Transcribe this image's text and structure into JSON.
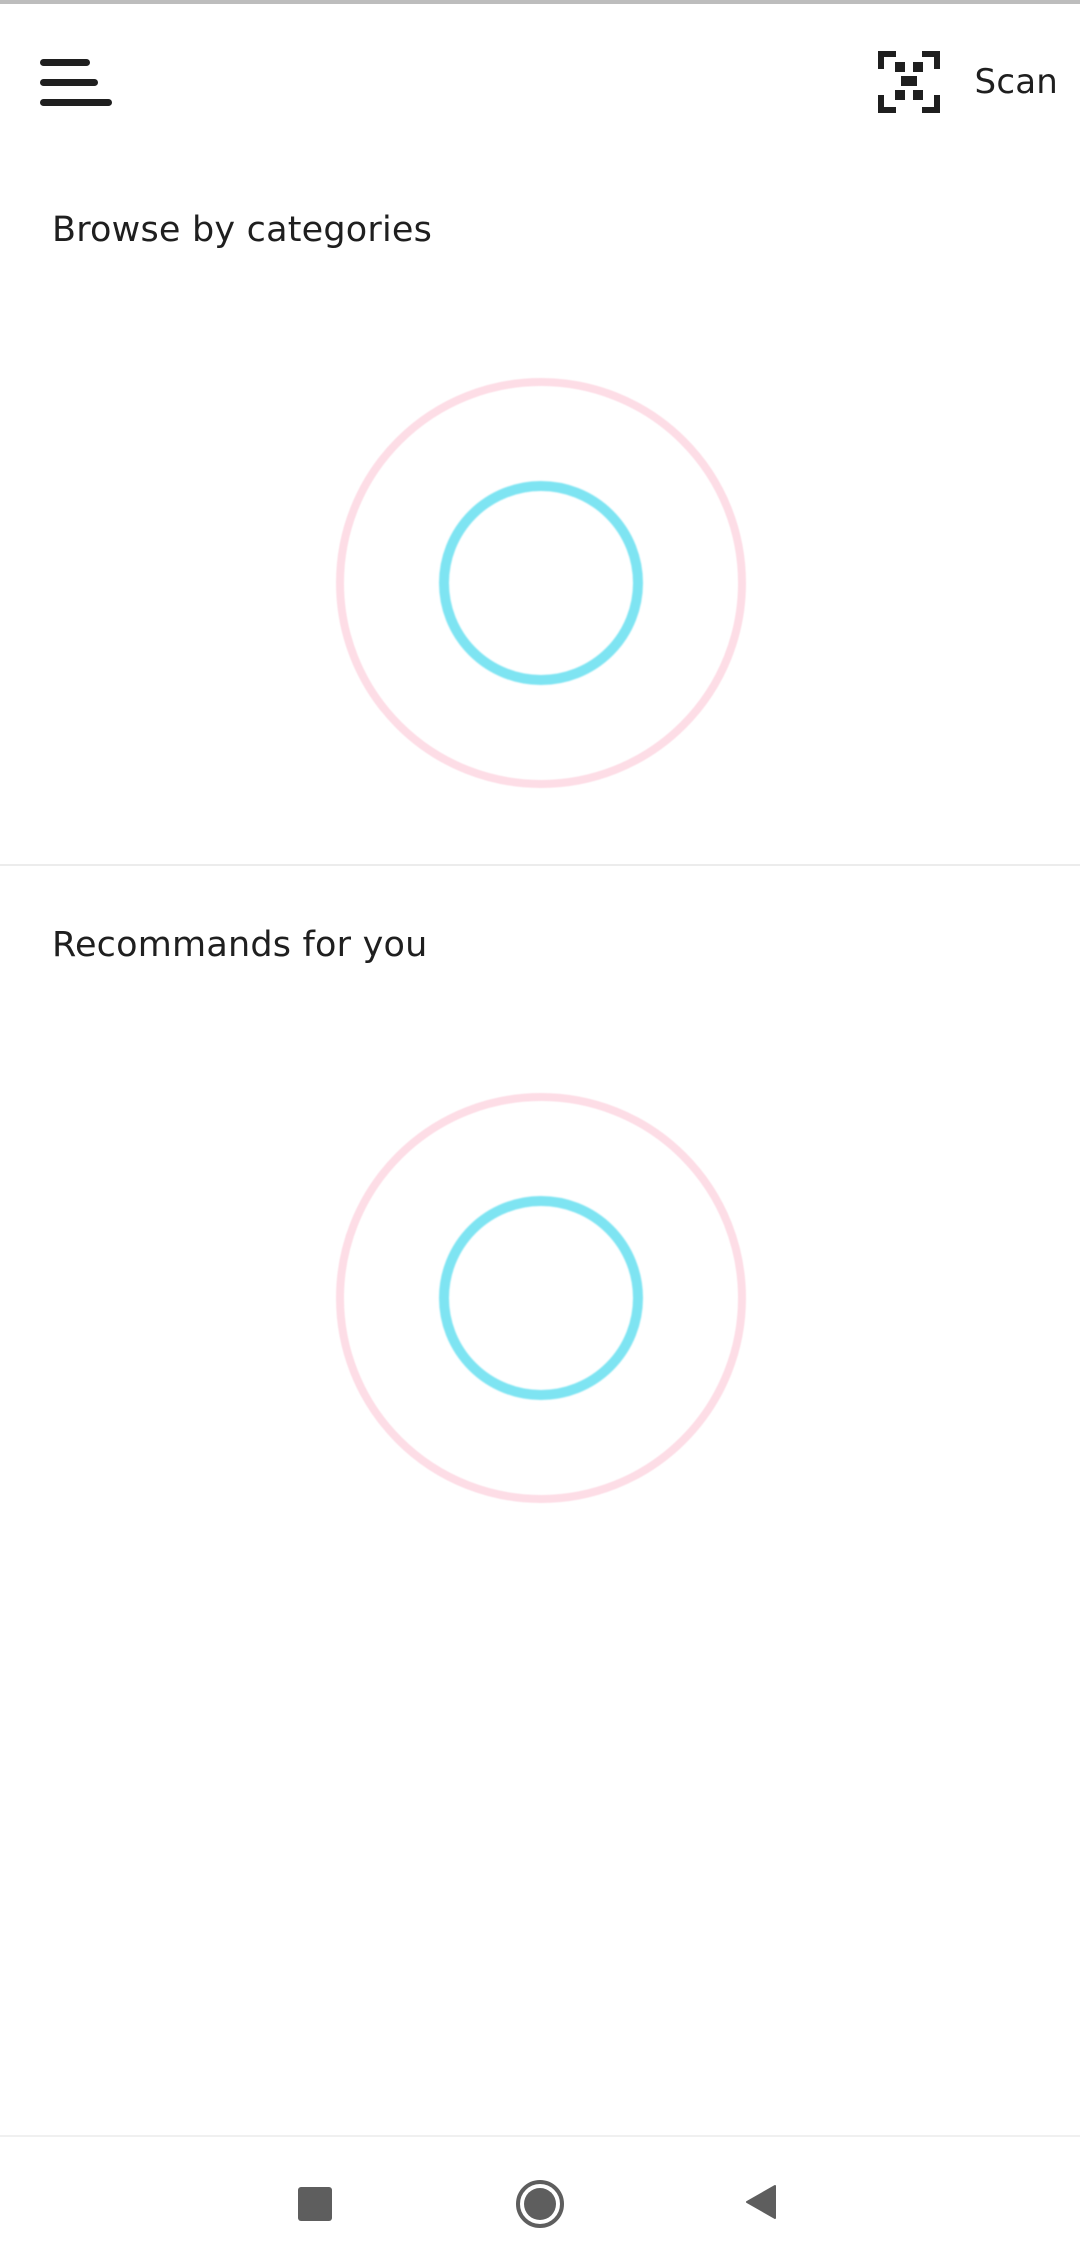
{
  "header": {
    "menu_icon": "hamburger-menu-icon",
    "scan_icon": "qr-scan-icon",
    "scan_label": "Scan"
  },
  "sections": [
    {
      "title": "Browse by categories",
      "loading_indicator": "double-ring-spinner"
    },
    {
      "title": "Recommands for you",
      "loading_indicator": "double-ring-spinner"
    }
  ],
  "colors": {
    "spinner_outer": "#fddde6",
    "spinner_inner": "#7ee4f2",
    "text": "#1f1f1f",
    "nav_icon": "#5e5e5e"
  },
  "nav": {
    "recents_icon": "square-recents-icon",
    "home_icon": "circle-home-icon",
    "back_icon": "triangle-back-icon"
  }
}
